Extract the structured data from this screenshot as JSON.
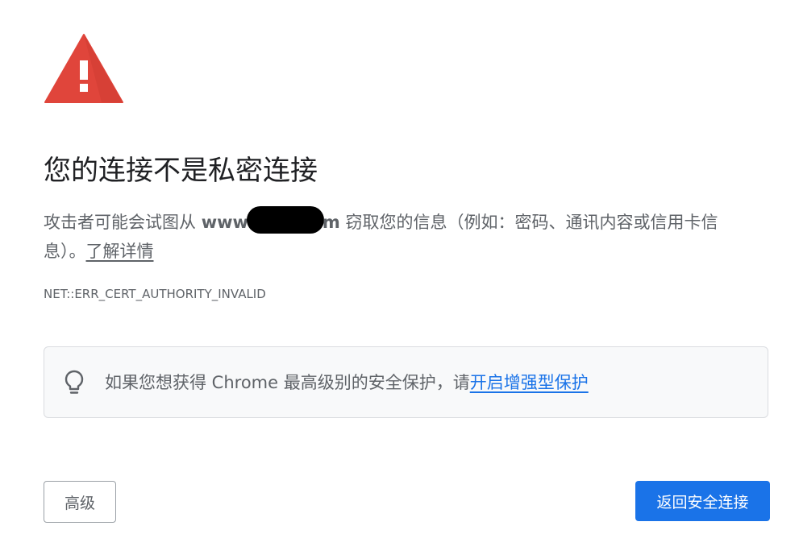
{
  "colors": {
    "warning_red": "#e0453b",
    "primary_blue": "#1a73e8",
    "text_primary": "#202124",
    "text_secondary": "#5f6368",
    "box_background": "#f8f9fa",
    "box_border": "#dadce0"
  },
  "icons": {
    "warning": "warning-triangle-icon",
    "tip": "lightbulb-icon"
  },
  "interstitial": {
    "title": "您的连接不是私密连接",
    "message": {
      "before_domain": "攻击者可能会试图从 ",
      "domain_start": "www",
      "domain_end": "m",
      "after_domain": " 窃取您的信息（例如：密码、通讯内容或信用卡信息）。",
      "learn_more": "了解详情"
    },
    "error_code": "NET::ERR_CERT_AUTHORITY_INVALID",
    "enhanced_protection": {
      "text": "如果您想获得 Chrome 最高级别的安全保护，请",
      "link": "开启增强型保护"
    },
    "buttons": {
      "advanced": "高级",
      "back_to_safety": "返回安全连接"
    }
  }
}
